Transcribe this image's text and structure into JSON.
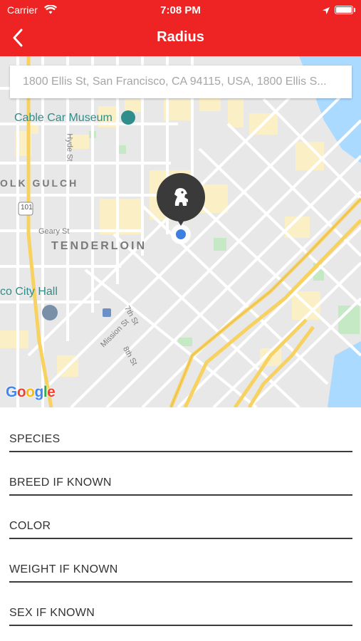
{
  "status_bar": {
    "carrier": "Carrier",
    "time": "7:08 PM"
  },
  "nav": {
    "title": "Radius",
    "back_icon": "chevron-left-icon"
  },
  "map": {
    "search_placeholder": "1800 Ellis St, San Francisco, CA 94115, USA, 1800 Ellis S...",
    "labels": {
      "cable_car_museum": "Cable Car Museum",
      "polk_gulch": "OLK GULCH",
      "tenderloin": "TENDERLOIN",
      "city_hall": "co City Hall",
      "hyde_st": "Hyde St",
      "geary_st": "Geary St",
      "mission_st": "Mission St",
      "seventh_st": "7th St",
      "eighth_st": "8th St",
      "route_101": "101"
    },
    "attribution": "Google",
    "pin_icon": "dog-paw-pin-icon",
    "colors": {
      "water": "#aadaff",
      "highway": "#f7d261",
      "park": "#c5e8c5",
      "building": "#fbefc5"
    }
  },
  "form": {
    "fields": [
      {
        "label": "SPECIES"
      },
      {
        "label": "BREED IF KNOWN"
      },
      {
        "label": "COLOR"
      },
      {
        "label": "WEIGHT IF KNOWN"
      },
      {
        "label": "SEX IF KNOWN"
      }
    ]
  },
  "colors": {
    "brand_red": "#ee2424",
    "field_underline": "#3c3c3c",
    "location_dot": "#3d7fe0"
  }
}
